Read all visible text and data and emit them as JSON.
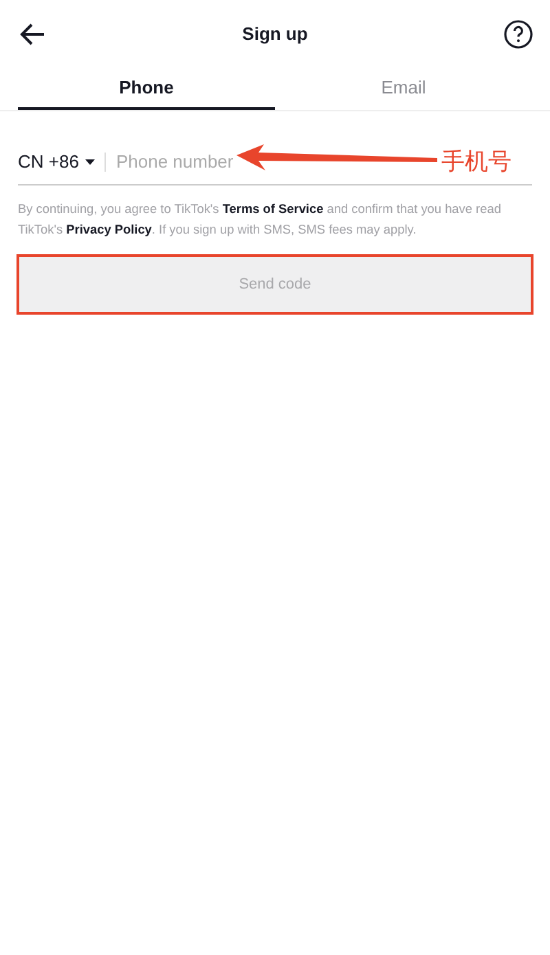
{
  "header": {
    "title": "Sign up"
  },
  "tabs": [
    {
      "label": "Phone",
      "selected": true
    },
    {
      "label": "Email",
      "selected": false
    }
  ],
  "phone": {
    "country": "CN +86",
    "placeholder": "Phone number"
  },
  "annotation": {
    "label": "手机号",
    "color": "#e8452c"
  },
  "legal": [
    {
      "kind": "text",
      "text": "By continuing, you agree to TikTok's "
    },
    {
      "kind": "link",
      "text": "Terms of Service"
    },
    {
      "kind": "text",
      "text": " and confirm that you have read TikTok's "
    },
    {
      "kind": "link",
      "text": "Privacy Policy"
    },
    {
      "kind": "text",
      "text": ". If you sign up with SMS, SMS fees may apply."
    }
  ],
  "send_button": {
    "label": "Send code",
    "disabled": true,
    "highlighted": true
  }
}
